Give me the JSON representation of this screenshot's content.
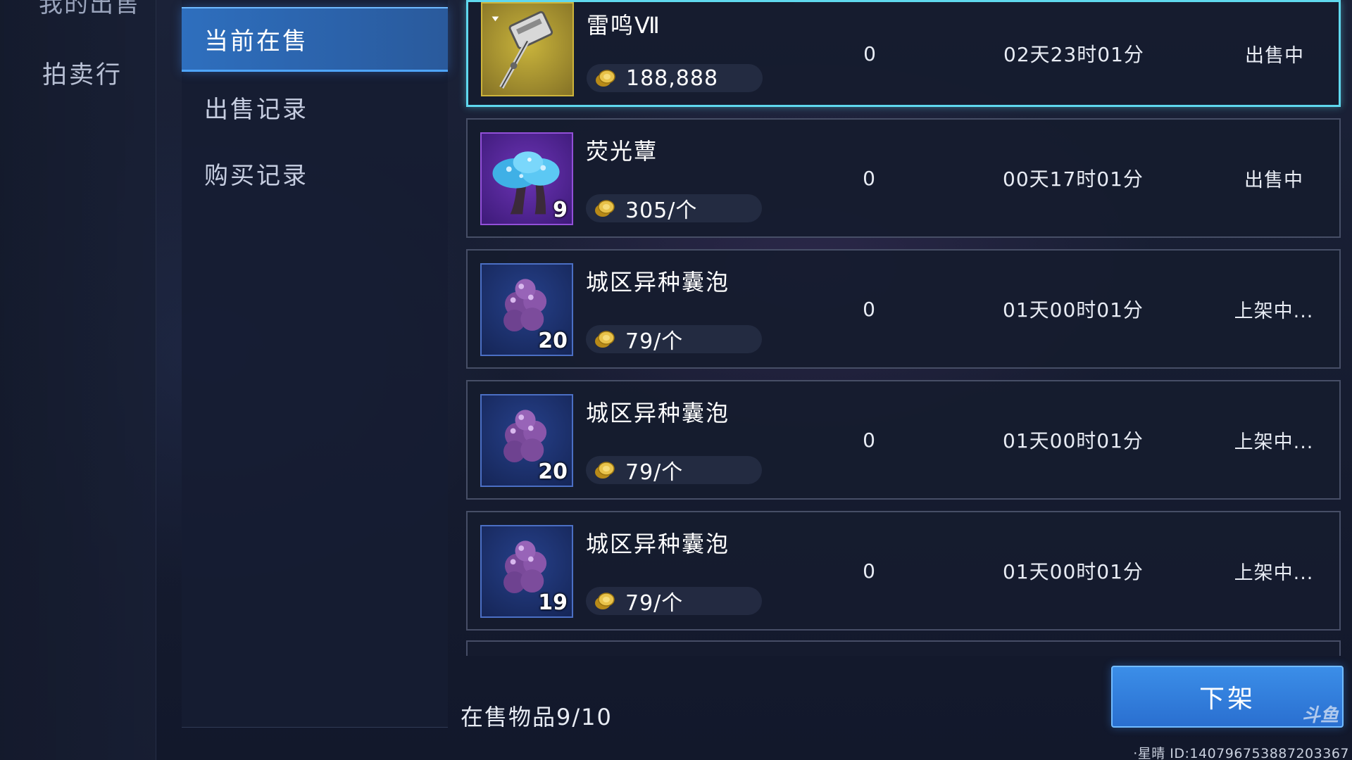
{
  "left_nav": {
    "cut_item_label": "我的出售",
    "auction_label": "拍卖行"
  },
  "sub_menu": {
    "items": [
      {
        "label": "当前在售",
        "active": true
      },
      {
        "label": "出售记录",
        "active": false
      },
      {
        "label": "购买记录",
        "active": false
      }
    ]
  },
  "listings": [
    {
      "name": "雷鸣Ⅶ",
      "price": "188,888",
      "quantity": "",
      "bids": "0",
      "time_left": "02天23时01分",
      "status": "出售中",
      "icon": "hammer-weapon-icon",
      "rarity_color": "#cdb43a"
    },
    {
      "name": "荧光蕈",
      "price": "305/个",
      "quantity": "9",
      "bids": "0",
      "time_left": "00天17时01分",
      "status": "出售中",
      "icon": "glowing-mushroom-icon",
      "rarity_color": "#9250d8"
    },
    {
      "name": "城区异种囊泡",
      "price": "79/个",
      "quantity": "20",
      "bids": "0",
      "time_left": "01天00时01分",
      "status": "上架中...",
      "icon": "vesicle-cluster-icon",
      "rarity_color": "#4b6fc4"
    },
    {
      "name": "城区异种囊泡",
      "price": "79/个",
      "quantity": "20",
      "bids": "0",
      "time_left": "01天00时01分",
      "status": "上架中...",
      "icon": "vesicle-cluster-icon",
      "rarity_color": "#4b6fc4"
    },
    {
      "name": "城区异种囊泡",
      "price": "79/个",
      "quantity": "19",
      "bids": "0",
      "time_left": "01天00时01分",
      "status": "上架中...",
      "icon": "vesicle-cluster-icon",
      "rarity_color": "#4b6fc4"
    }
  ],
  "footer": {
    "on_sale_count": "在售物品9/10",
    "delist_button": "下架",
    "watermark": "斗鱼",
    "player_id": "·星晴 ID:140796753887203367"
  },
  "colors": {
    "accent_cyan": "#5fd8ee",
    "button_blue": "#2a6fd0",
    "active_tab_blue": "#2e6fbe"
  }
}
